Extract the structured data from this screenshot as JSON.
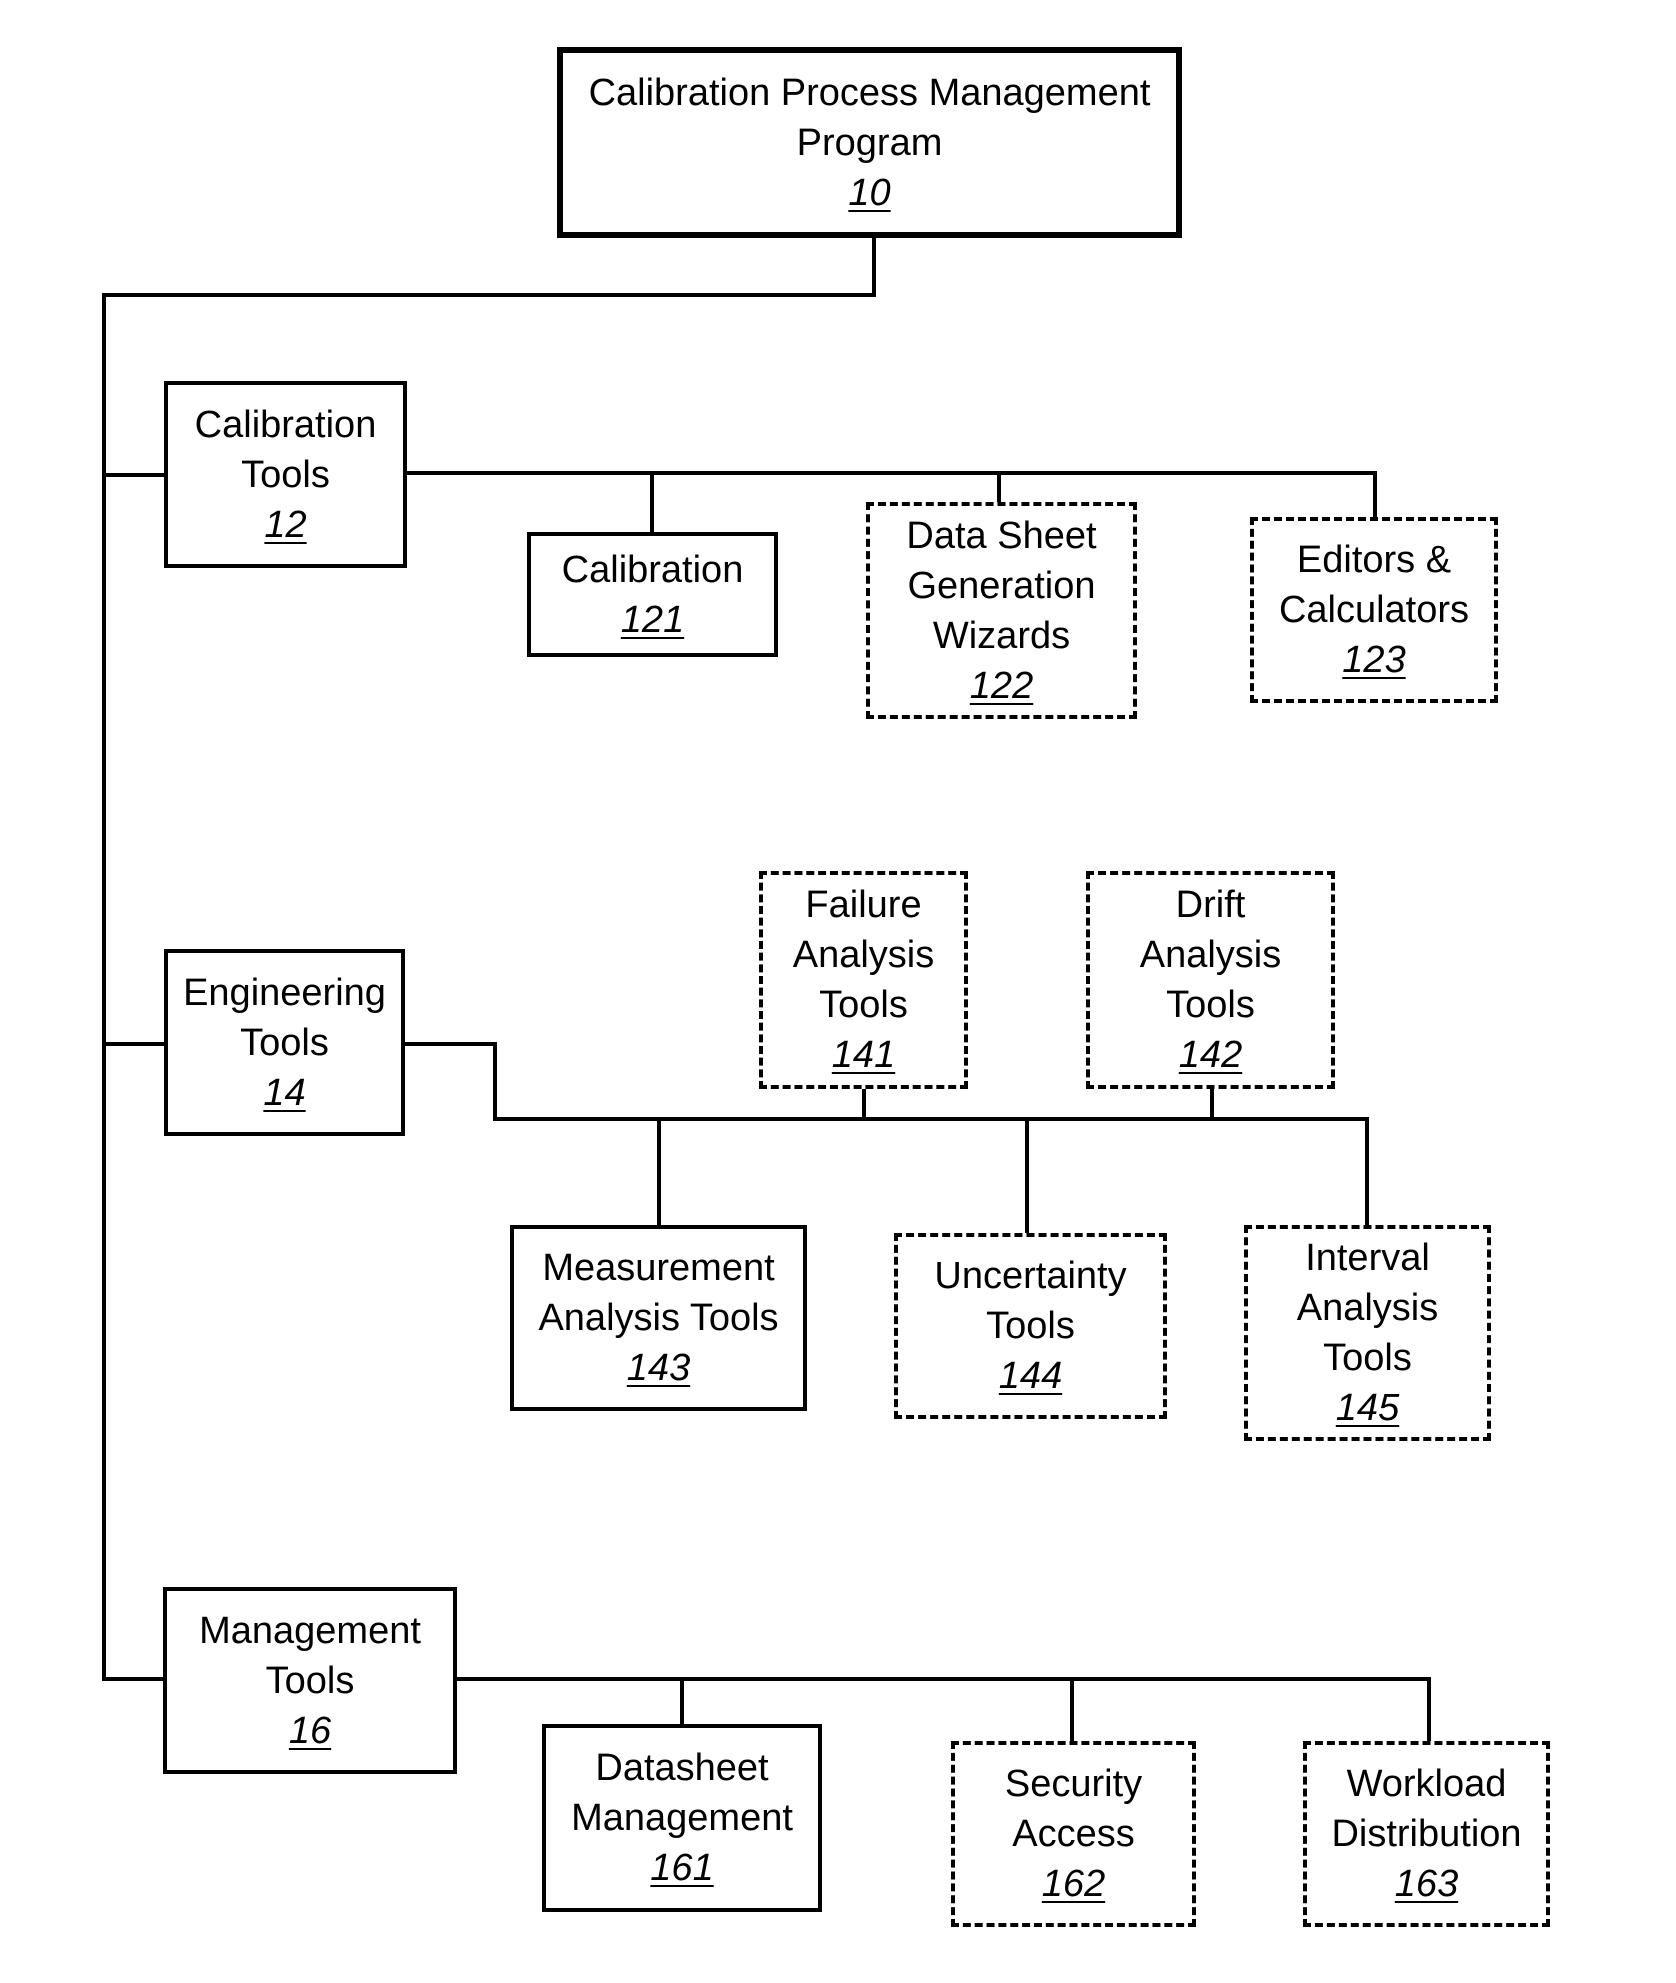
{
  "diagram": {
    "root": {
      "lines": [
        "Calibration Process Management",
        "Program"
      ],
      "ref": "10",
      "style": "solid"
    },
    "calibration_tools": {
      "lines": [
        "Calibration",
        "Tools"
      ],
      "ref": "12",
      "style": "solid",
      "children": [
        {
          "lines": [
            "Calibration"
          ],
          "ref": "121",
          "style": "solid"
        },
        {
          "lines": [
            "Data Sheet",
            "Generation",
            "Wizards"
          ],
          "ref": "122",
          "style": "dashed"
        },
        {
          "lines": [
            "Editors &",
            "Calculators"
          ],
          "ref": "123",
          "style": "dashed"
        }
      ]
    },
    "engineering_tools": {
      "lines": [
        "Engineering",
        "Tools"
      ],
      "ref": "14",
      "style": "solid",
      "children": [
        {
          "lines": [
            "Failure",
            "Analysis",
            "Tools"
          ],
          "ref": "141",
          "style": "dashed"
        },
        {
          "lines": [
            "Drift",
            "Analysis",
            "Tools"
          ],
          "ref": "142",
          "style": "dashed"
        },
        {
          "lines": [
            "Measurement",
            "Analysis Tools"
          ],
          "ref": "143",
          "style": "solid"
        },
        {
          "lines": [
            "Uncertainty",
            "Tools"
          ],
          "ref": "144",
          "style": "dashed"
        },
        {
          "lines": [
            "Interval",
            "Analysis",
            "Tools"
          ],
          "ref": "145",
          "style": "dashed"
        }
      ]
    },
    "management_tools": {
      "lines": [
        "Management",
        "Tools"
      ],
      "ref": "16",
      "style": "solid",
      "children": [
        {
          "lines": [
            "Datasheet",
            "Management"
          ],
          "ref": "161",
          "style": "solid"
        },
        {
          "lines": [
            "Security",
            "Access"
          ],
          "ref": "162",
          "style": "dashed"
        },
        {
          "lines": [
            "Workload",
            "Distribution"
          ],
          "ref": "163",
          "style": "dashed"
        }
      ]
    }
  }
}
